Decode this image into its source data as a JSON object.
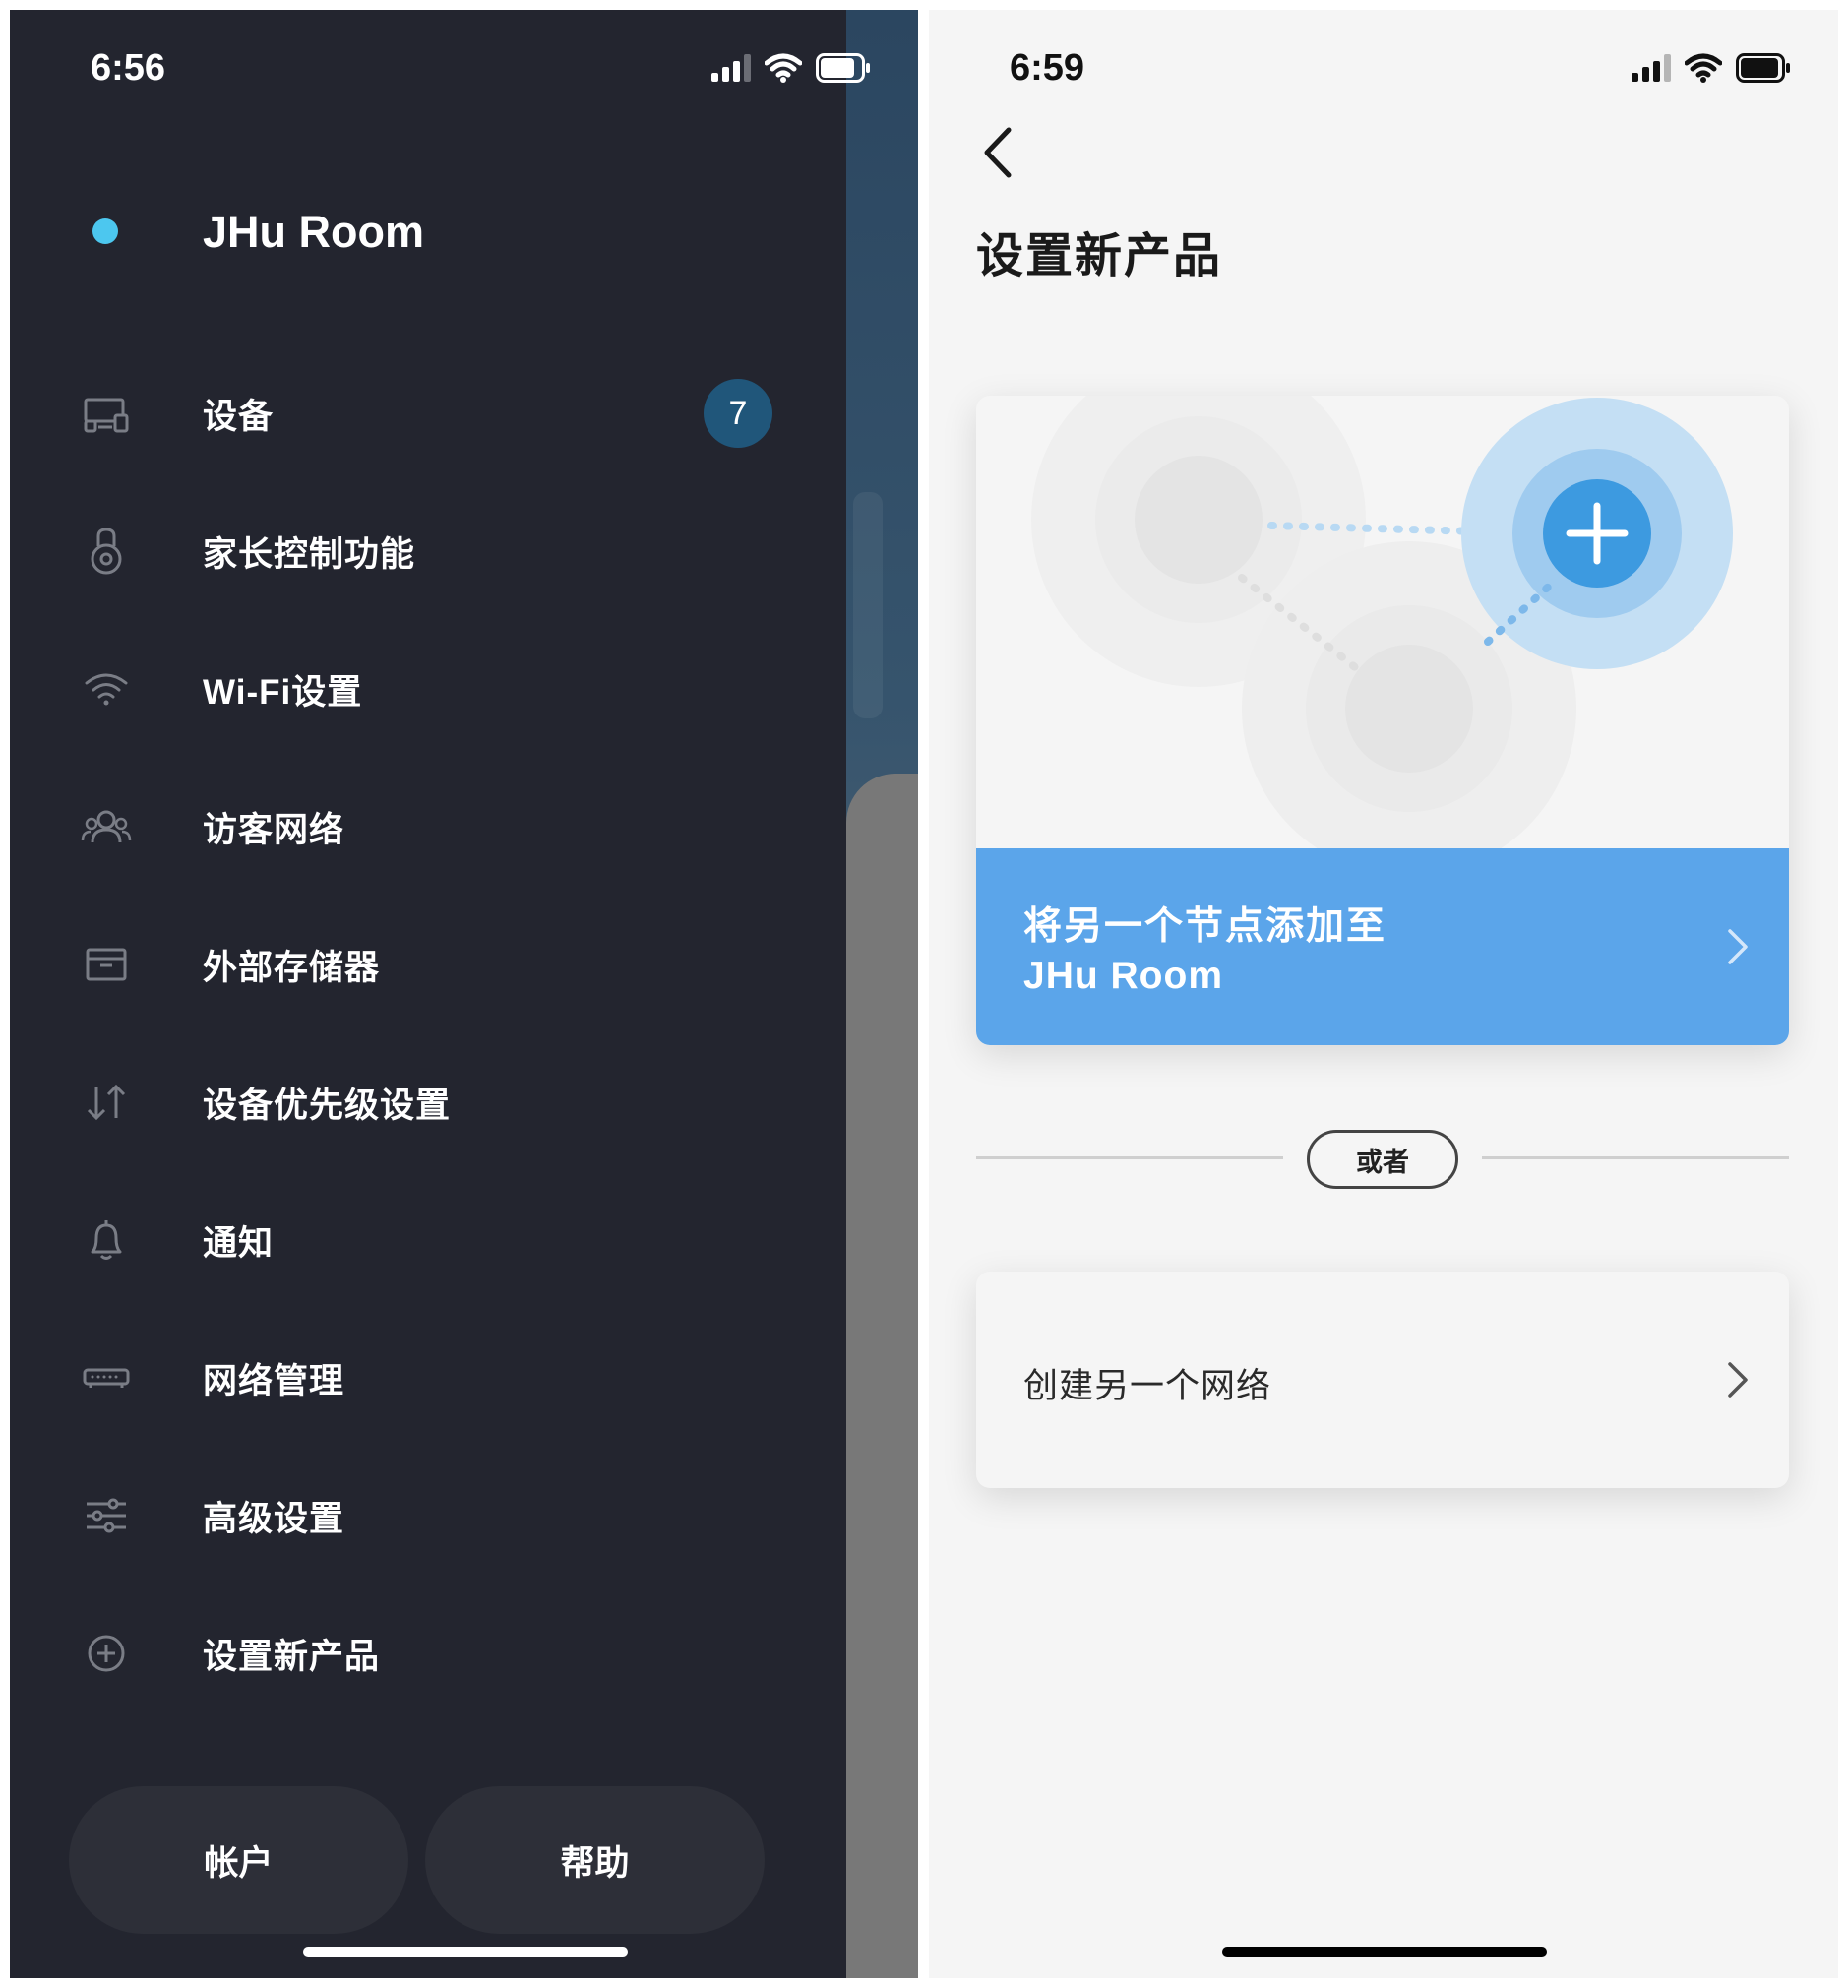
{
  "left_screen": {
    "status_time": "6:56",
    "network": {
      "name": "JHu Room",
      "status_color": "#4cc7ef"
    },
    "menu": [
      {
        "label": "设备",
        "icon": "devices-icon",
        "badge": "7"
      },
      {
        "label": "家长控制功能",
        "icon": "lock-icon"
      },
      {
        "label": "Wi-Fi设置",
        "icon": "wifi-icon"
      },
      {
        "label": "访客网络",
        "icon": "guests-icon"
      },
      {
        "label": "外部存储器",
        "icon": "storage-icon"
      },
      {
        "label": "设备优先级设置",
        "icon": "priority-arrows-icon"
      },
      {
        "label": "通知",
        "icon": "bell-icon"
      },
      {
        "label": "网络管理",
        "icon": "router-icon"
      },
      {
        "label": "高级设置",
        "icon": "sliders-icon"
      },
      {
        "label": "设置新产品",
        "icon": "plus-circle-icon"
      }
    ],
    "buttons": {
      "account": "帐户",
      "help": "帮助"
    }
  },
  "right_screen": {
    "status_time": "6:59",
    "title": "设置新产品",
    "add_node": {
      "line1": "将另一个节点添加至",
      "line2": "JHu Room"
    },
    "or_label": "或者",
    "create_network": "创建另一个网络"
  },
  "colors": {
    "drawer_bg": "#23252f",
    "accent_blue": "#5ba5ea",
    "badge_bg": "#20567a",
    "plus_node": "#3d9ae0"
  }
}
